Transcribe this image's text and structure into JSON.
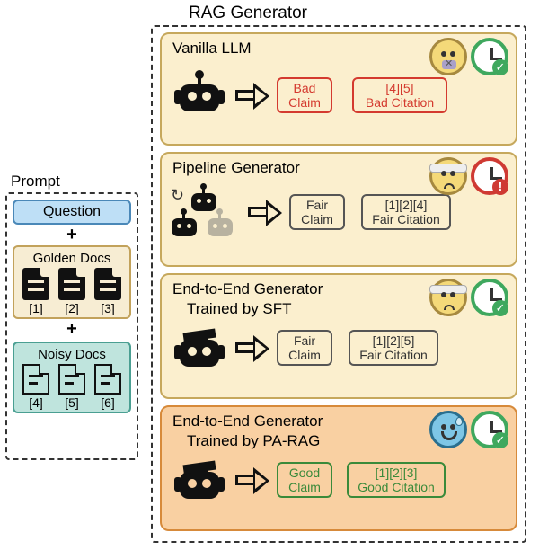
{
  "prompt": {
    "label": "Prompt",
    "question": "Question",
    "golden_title": "Golden Docs",
    "golden_ids": [
      "[1]",
      "[2]",
      "[3]"
    ],
    "noisy_title": "Noisy Docs",
    "noisy_ids": [
      "[4]",
      "[5]",
      "[6]"
    ],
    "plus": "+"
  },
  "rag": {
    "label": "RAG Generator",
    "cards": [
      {
        "title": "Vanilla LLM",
        "claim": "Bad Claim",
        "citation_ids": "[4][5]",
        "citation_label": "Bad Citation",
        "face": "mute",
        "clock": "green"
      },
      {
        "title": "Pipeline Generator",
        "claim": "Fair Claim",
        "citation_ids": "[1][2][4]",
        "citation_label": "Fair Citation",
        "face": "sick",
        "clock": "red"
      },
      {
        "title": "End-to-End Generator",
        "subtitle": "Trained by SFT",
        "claim": "Fair Claim",
        "citation_ids": "[1][2][5]",
        "citation_label": "Fair Citation",
        "face": "sick",
        "clock": "green"
      },
      {
        "title": "End-to-End Generator",
        "subtitle": "Trained by PA-RAG",
        "claim": "Good Claim",
        "citation_ids": "[1][2][3]",
        "citation_label": "Good Citation",
        "face": "happy",
        "clock": "green"
      }
    ]
  }
}
